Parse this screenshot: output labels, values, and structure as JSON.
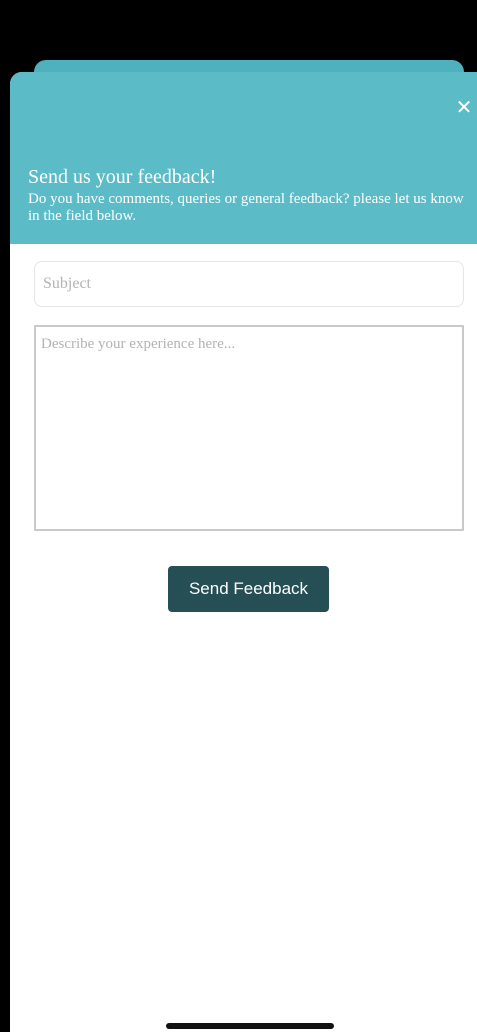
{
  "header": {
    "title": "Send us your feedback!",
    "subtitle": "Do you have comments, queries or general feedback? please let us know in the field below.",
    "close_icon": "close-icon"
  },
  "form": {
    "subject_placeholder": "Subject",
    "subject_value": "",
    "experience_placeholder": "Describe your experience here...",
    "experience_value": "",
    "send_label": "Send Feedback"
  },
  "colors": {
    "header_background": "#5bbcc8",
    "button_background": "#254f55",
    "page_background": "#ffffff"
  }
}
